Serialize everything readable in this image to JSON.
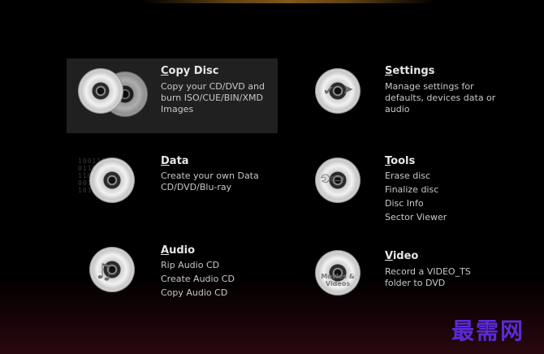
{
  "menu": {
    "copy_disc": {
      "title_initial": "C",
      "title_rest": "opy Disc",
      "desc": [
        "Copy your CD/DVD and",
        "burn ISO/CUE/BIN/XMD",
        "Images"
      ]
    },
    "settings": {
      "title_initial": "S",
      "title_rest": "ettings",
      "desc": [
        "Manage settings for",
        "defaults, devices data or",
        "audio"
      ]
    },
    "data": {
      "title_initial": "D",
      "title_rest": "ata",
      "desc": [
        "Create your own Data",
        "CD/DVD/Blu-ray"
      ]
    },
    "tools": {
      "title_initial": "T",
      "title_rest": "ools",
      "items": [
        "Erase disc",
        "Finalize disc",
        "Disc Info",
        "Sector Viewer"
      ]
    },
    "audio": {
      "title_initial": "A",
      "title_rest": "udio",
      "items": [
        "Rip Audio CD",
        "Create Audio CD",
        "Copy Audio CD"
      ]
    },
    "video": {
      "title_initial": "V",
      "title_rest": "ideo",
      "desc": [
        "Record a VIDEO_TS",
        "folder to DVD"
      ],
      "disc_label": [
        "Movies &",
        "Videos"
      ]
    }
  },
  "watermark": "最需网",
  "icons": {
    "copy_disc": "two-discs-icon",
    "settings": "check-disc-icon",
    "data": "binary-disc-icon",
    "tools": "wrench-disc-icon",
    "audio": "music-note-disc-icon",
    "video": "film-disc-icon"
  }
}
